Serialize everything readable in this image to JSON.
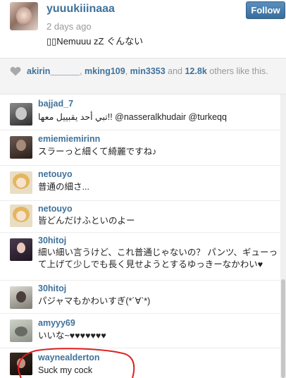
{
  "post": {
    "username": "yuuukiiinaaa",
    "time": "2 days ago",
    "caption": "▯▯Nemuuu zZ ぐんない",
    "follow_label": "Follow"
  },
  "likes": {
    "names": [
      "akirin______",
      "mking109",
      "min3353"
    ],
    "sep1": ", ",
    "sep2": ", ",
    "and_text": " and ",
    "others_count": "12.8k",
    "others_suffix": " others like this."
  },
  "comments": [
    {
      "user": "bajjad_7",
      "text": "تبي أحد يقبييل معها!! @nasseralkhudair @turkeqq"
    },
    {
      "user": "emiemiemirinn",
      "text": "スラーっと細くて綺麗ですね♪"
    },
    {
      "user": "netouyo",
      "text": "普通の細さ..."
    },
    {
      "user": "netouyo",
      "text": "皆どんだけふといのよー"
    },
    {
      "user": "30hitoj",
      "text": "細い細い言うけど、これ普通じゃないの？ パンツ、ギューって上げて少しでも長く見せようとするゆっきーなかわい♥"
    },
    {
      "user": "30hitoj",
      "text": "パジャマもかわいすぎ(*´∀`*)"
    },
    {
      "user": "amyyy69",
      "text": "いいな~♥♥♥♥♥♥♥"
    },
    {
      "user": "waynealderton",
      "text": "Suck my cock"
    }
  ],
  "colors": {
    "link": "#3f729b",
    "follow_button": "#3f729b",
    "annotation": "#e02020"
  },
  "icons": {
    "likes": "heart-icon"
  }
}
